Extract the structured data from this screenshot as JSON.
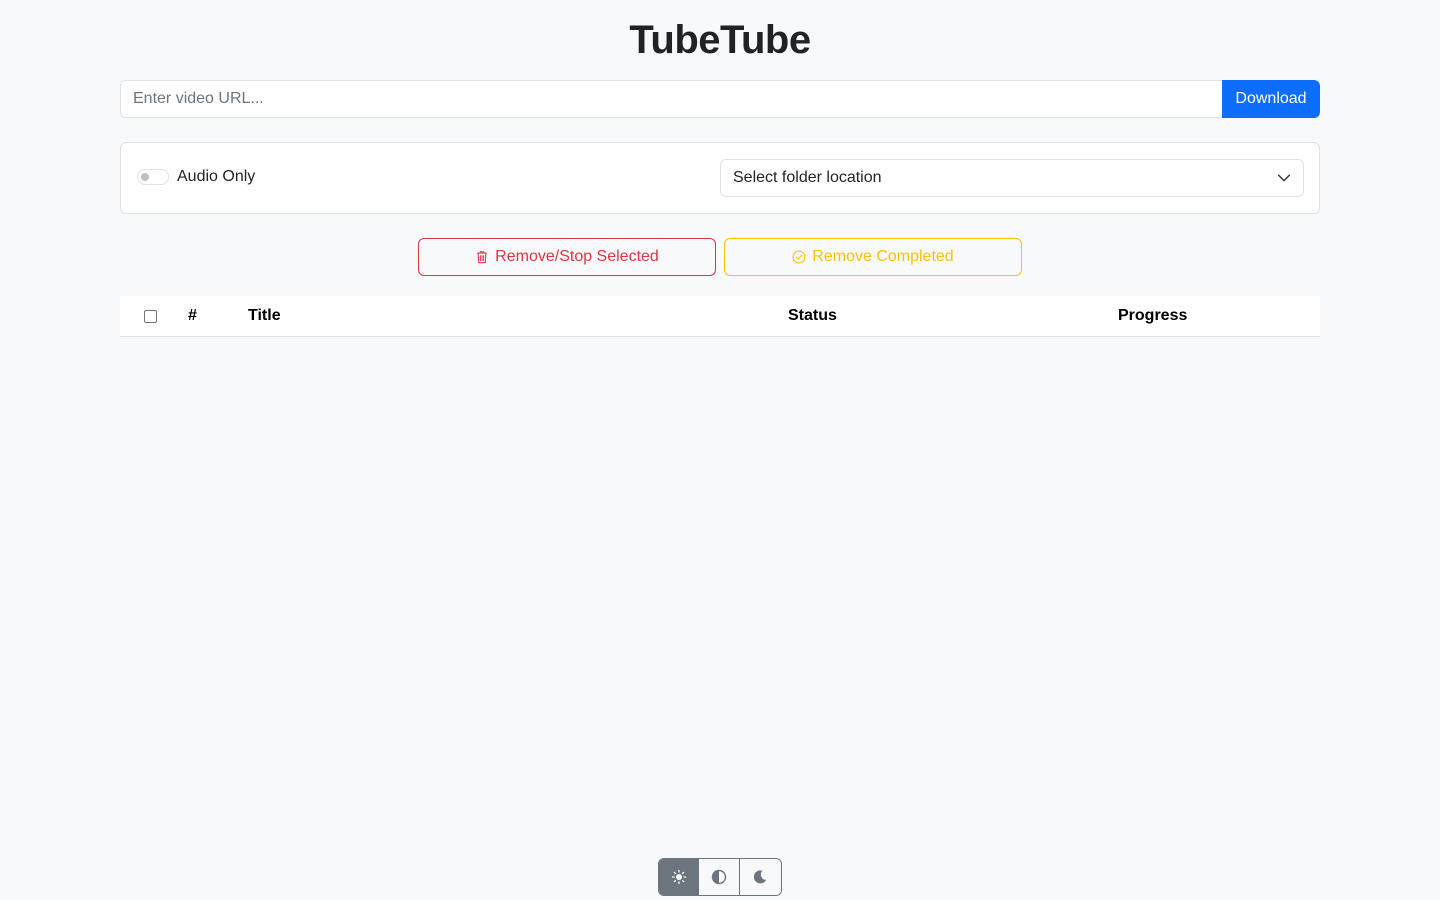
{
  "app": {
    "title": "TubeTube"
  },
  "url_bar": {
    "placeholder": "Enter video URL...",
    "value": "",
    "download_label": "Download"
  },
  "options": {
    "audio_only_label": "Audio Only",
    "audio_only_on": false,
    "folder_select_value": "Select folder location"
  },
  "actions": {
    "remove_stop_label": "Remove/Stop Selected",
    "remove_completed_label": "Remove Completed"
  },
  "table": {
    "columns": [
      "#",
      "Title",
      "Status",
      "Progress"
    ],
    "rows": []
  },
  "theme": {
    "options": [
      "light",
      "auto",
      "dark"
    ],
    "selected": "light"
  },
  "colors": {
    "primary": "#0d6efd",
    "danger": "#dc3545",
    "warning": "#ffc107",
    "secondary": "#6c757d",
    "background": "#f8f9fb"
  }
}
